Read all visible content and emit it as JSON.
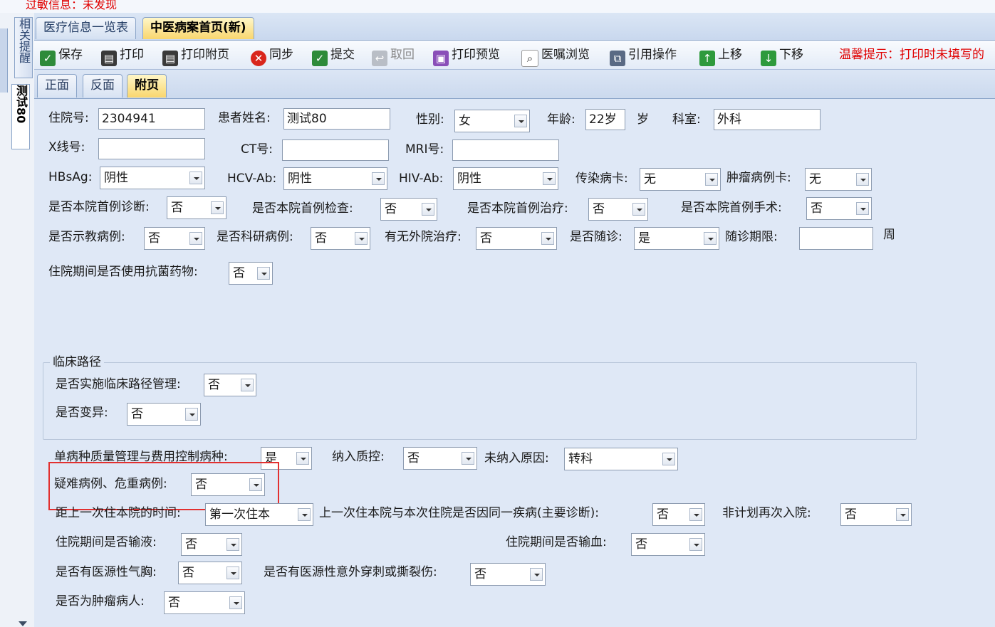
{
  "top_banner": "过敏信息：未发现",
  "left_tabs": {
    "related_reminder": "相关提醒",
    "patient_tab": "测试80"
  },
  "main_tabs": [
    {
      "label": "医疗信息一览表"
    },
    {
      "label": "中医病案首页(新)"
    }
  ],
  "toolbar": {
    "save": "保存",
    "print": "打印",
    "print_attach": "打印附页",
    "sync": "同步",
    "submit": "提交",
    "retrieve": "取回",
    "print_preview": "打印预览",
    "order_browse": "医嘱浏览",
    "quote_op": "引用操作",
    "move_up": "上移",
    "move_down": "下移",
    "hint": "温馨提示：打印时未填写的"
  },
  "sub_tabs": [
    {
      "label": "正面"
    },
    {
      "label": "反面"
    },
    {
      "label": "附页"
    }
  ],
  "form": {
    "admission_no": {
      "label": "住院号:",
      "value": "2304941"
    },
    "patient_name": {
      "label": "患者姓名:",
      "value": "测试80"
    },
    "gender": {
      "label": "性别:",
      "value": "女"
    },
    "age": {
      "label": "年龄:",
      "value": "22岁",
      "unit": "岁"
    },
    "department": {
      "label": "科室:",
      "value": "外科"
    },
    "xray_no": {
      "label": "X线号:",
      "value": ""
    },
    "ct_no": {
      "label": "CT号:",
      "value": ""
    },
    "mri_no": {
      "label": "MRI号:",
      "value": ""
    },
    "hbsag": {
      "label": "HBsAg:",
      "value": "阴性"
    },
    "hcv_ab": {
      "label": "HCV-Ab:",
      "value": "阴性"
    },
    "hiv_ab": {
      "label": "HIV-Ab:",
      "value": "阴性"
    },
    "infect_card": {
      "label": "传染病卡:",
      "value": "无"
    },
    "tumor_card": {
      "label": "肿瘤病例卡:",
      "value": "无"
    },
    "first_diag": {
      "label": "是否本院首例诊断:",
      "value": "否"
    },
    "first_exam": {
      "label": "是否本院首例检查:",
      "value": "否"
    },
    "first_treat": {
      "label": "是否本院首例治疗:",
      "value": "否"
    },
    "first_surgery": {
      "label": "是否本院首例手术:",
      "value": "否"
    },
    "teaching_case": {
      "label": "是否示教病例:",
      "value": "否"
    },
    "research_case": {
      "label": "是否科研病例:",
      "value": "否"
    },
    "outside_treat": {
      "label": "有无外院治疗:",
      "value": "否"
    },
    "follow_up": {
      "label": "是否随诊:",
      "value": "是"
    },
    "follow_period": {
      "label": "随诊期限:",
      "value": "",
      "unit": "周"
    },
    "antibiotics": {
      "label": "住院期间是否使用抗菌药物:",
      "value": "否"
    },
    "clinical_path": {
      "title": "临床路径",
      "implemented": {
        "label": "是否实施临床路径管理:",
        "value": "否"
      },
      "variation": {
        "label": "是否变异:",
        "value": "否"
      }
    },
    "single_disease": {
      "label": "单病种质量管理与费用控制病种:",
      "value": "是"
    },
    "quality_control": {
      "label": "纳入质控:",
      "value": "否"
    },
    "not_included_reason": {
      "label": "未纳入原因:",
      "value": "转科"
    },
    "difficult_case": {
      "label": "疑难病例、危重病例:",
      "value": "否"
    },
    "last_admission": {
      "label": "距上一次住本院的时间:",
      "value": "第一次住本"
    },
    "same_disease": {
      "label": "上一次住本院与本次住院是否因同一疾病(主要诊断):",
      "value": "否"
    },
    "unplanned_readmit": {
      "label": "非计划再次入院:",
      "value": "否"
    },
    "infusion": {
      "label": "住院期间是否输液:",
      "value": "否"
    },
    "transfusion": {
      "label": "住院期间是否输血:",
      "value": "否"
    },
    "pneumothorax": {
      "label": "是否有医源性气胸:",
      "value": "否"
    },
    "puncture": {
      "label": "是否有医源性意外穿刺或撕裂伤:",
      "value": "否"
    },
    "tumor_patient": {
      "label": "是否为肿瘤病人:",
      "value": "否"
    }
  }
}
